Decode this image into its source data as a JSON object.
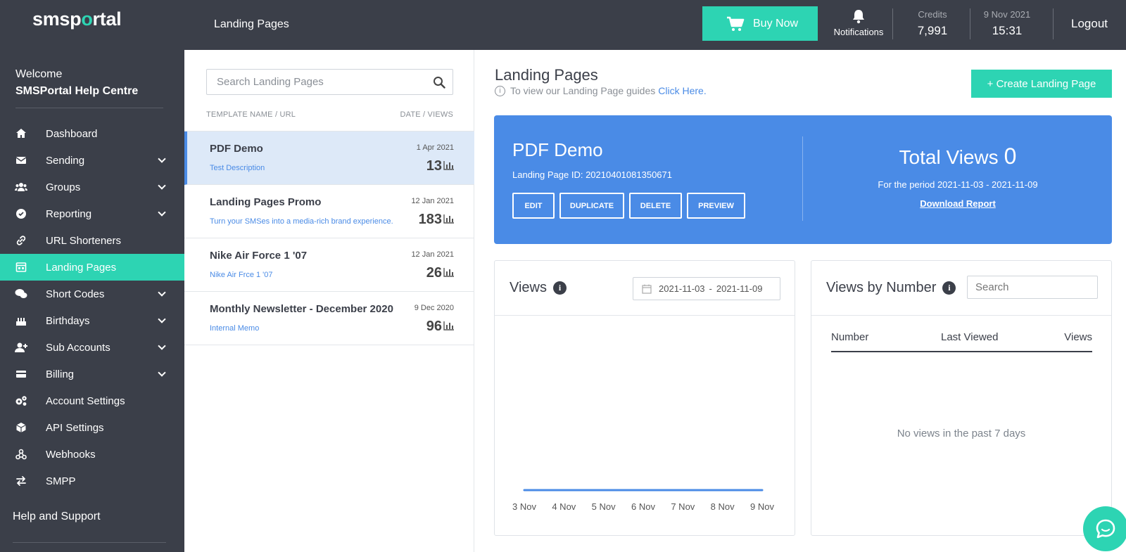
{
  "app": {
    "logo_prefix": "smsp",
    "logo_o": "o",
    "logo_suffix": "rtal"
  },
  "sidebar": {
    "welcome": "Welcome",
    "account_name": "SMSPortal Help Centre",
    "items": [
      {
        "label": "Dashboard",
        "icon": "home-icon",
        "chevron": false
      },
      {
        "label": "Sending",
        "icon": "envelope-icon",
        "chevron": true
      },
      {
        "label": "Groups",
        "icon": "users-icon",
        "chevron": true
      },
      {
        "label": "Reporting",
        "icon": "report-icon",
        "chevron": true
      },
      {
        "label": "URL Shorteners",
        "icon": "link-icon",
        "chevron": false
      },
      {
        "label": "Landing Pages",
        "icon": "landing-page-icon",
        "chevron": false,
        "active": true
      },
      {
        "label": "Short Codes",
        "icon": "chat-bubbles-icon",
        "chevron": true
      },
      {
        "label": "Birthdays",
        "icon": "cake-icon",
        "chevron": true
      },
      {
        "label": "Sub Accounts",
        "icon": "user-plus-icon",
        "chevron": true
      },
      {
        "label": "Billing",
        "icon": "credit-card-icon",
        "chevron": true
      },
      {
        "label": "Account Settings",
        "icon": "cogs-icon",
        "chevron": false
      },
      {
        "label": "API Settings",
        "icon": "cube-icon",
        "chevron": false
      },
      {
        "label": "Webhooks",
        "icon": "webhook-icon",
        "chevron": false
      },
      {
        "label": "SMPP",
        "icon": "exchange-icon",
        "chevron": false
      }
    ],
    "help": "Help and Support"
  },
  "topbar": {
    "page_title": "Landing Pages",
    "buy_now": "Buy Now",
    "notifications": "Notifications",
    "credits_label": "Credits",
    "credits_value": "7,991",
    "date": "9 Nov 2021",
    "time": "15:31",
    "logout": "Logout"
  },
  "list": {
    "search_placeholder": "Search Landing Pages",
    "col_left": "TEMPLATE NAME / URL",
    "col_right": "DATE / VIEWS",
    "rows": [
      {
        "title": "PDF Demo",
        "desc": "Test Description",
        "date": "1 Apr 2021",
        "views": "13",
        "selected": true
      },
      {
        "title": "Landing Pages Promo",
        "desc": "Turn your SMSes into a media-rich brand experience.",
        "date": "12 Jan 2021",
        "views": "183"
      },
      {
        "title": "Nike Air Force 1 '07",
        "desc": "Nike Air Frce 1 '07",
        "date": "12 Jan 2021",
        "views": "26"
      },
      {
        "title": "Monthly Newsletter - December 2020",
        "desc": "Internal Memo",
        "date": "9 Dec 2020",
        "views": "96"
      }
    ]
  },
  "main": {
    "title": "Landing Pages",
    "guide_text": "To view our Landing Page guides",
    "guide_link": "Click Here.",
    "create_button": "+ Create Landing Page",
    "banner": {
      "name": "PDF Demo",
      "page_id": "Landing Page ID: 20210401081350671",
      "buttons": [
        "EDIT",
        "DUPLICATE",
        "DELETE",
        "PREVIEW"
      ],
      "total_views_label": "Total Views",
      "total_views": "0",
      "period": "For the period 2021-11-03 - 2021-11-09",
      "download": "Download Report"
    },
    "views_card": {
      "title": "Views",
      "date_from": "2021-11-03",
      "date_sep": "-",
      "date_to": "2021-11-09"
    },
    "number_card": {
      "title": "Views by Number",
      "search_placeholder": "Search",
      "col_number": "Number",
      "col_last": "Last Viewed",
      "col_views": "Views",
      "empty": "No views in the past 7 days"
    }
  },
  "chart_data": {
    "type": "line",
    "categories": [
      "3 Nov",
      "4 Nov",
      "5 Nov",
      "6 Nov",
      "7 Nov",
      "8 Nov",
      "9 Nov"
    ],
    "series": [
      {
        "values": [
          0,
          0,
          0,
          0,
          0,
          0,
          0
        ]
      }
    ],
    "color": "#4a8be6",
    "grid": false
  },
  "colors": {
    "sidebar": "#3b3f49",
    "accent": "#2dd4b3",
    "banner": "#4a8be6"
  }
}
